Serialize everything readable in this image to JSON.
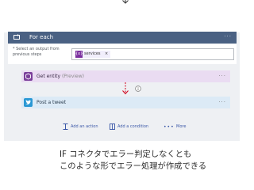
{
  "flow": {
    "foreach": {
      "title": "For each",
      "more_label": "···"
    },
    "select_output": {
      "label": "* Select an output from\nprevious steps",
      "token_icon": "{x}",
      "token_label": "services",
      "token_remove": "×"
    },
    "steps": [
      {
        "title": "Get entity",
        "suffix": "(Preview)",
        "more_label": "···",
        "icon": "entity-icon"
      },
      {
        "title": "Post a tweet",
        "more_label": "···",
        "icon": "twitter-icon"
      }
    ],
    "footer_actions": [
      {
        "label": "Add an action",
        "icon": "add-action-icon"
      },
      {
        "label": "Add a condition",
        "icon": "add-condition-icon"
      },
      {
        "label": "More",
        "icon": "more-icon"
      }
    ]
  },
  "caption": {
    "line1": "IF コネクタでエラー判定しなくとも",
    "line2": "このような形でエラー処理が作成できる"
  },
  "colors": {
    "foreach_header": "#4a6183",
    "get_entity_bg": "#eadcf2",
    "post_tweet_bg": "#dceaf6",
    "connector_red": "#d0021b",
    "link_blue": "#3a57a7"
  }
}
